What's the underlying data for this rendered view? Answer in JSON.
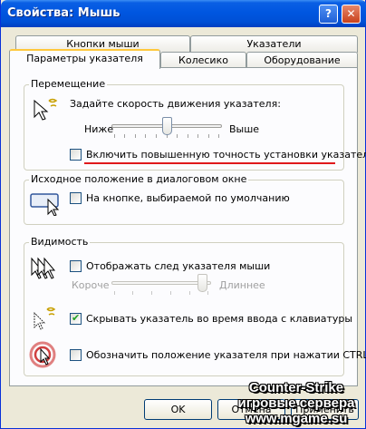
{
  "window": {
    "title": "Свойства: Мышь",
    "help_glyph": "?",
    "close_glyph": "✕"
  },
  "tabs": {
    "row_back": [
      {
        "label": "Кнопки мыши"
      },
      {
        "label": "Указатели"
      }
    ],
    "row_front": [
      {
        "label": "Параметры указателя",
        "active": true
      },
      {
        "label": "Колесико"
      },
      {
        "label": "Оборудование"
      }
    ]
  },
  "motion": {
    "legend": "Перемещение",
    "speed_label": "Задайте скорость движения указателя:",
    "slow_label": "Ниже",
    "fast_label": "Выше",
    "speed_level": 0.5,
    "precision_label": "Включить повышенную точность установки указателя",
    "precision_checked": false,
    "icon": "pointer-speed-icon"
  },
  "snap_to": {
    "legend": "Исходное положение в диалоговом окне",
    "label": "На кнопке, выбираемой по умолчанию",
    "checked": false,
    "icon": "snap-to-button-icon"
  },
  "visibility": {
    "legend": "Видимость",
    "trails_label": "Отображать след указателя мыши",
    "trails_checked": false,
    "trails_short": "Короче",
    "trails_long": "Длиннее",
    "trails_level": 1.0,
    "hide_label": "Скрывать указатель во время ввода с клавиатуры",
    "hide_checked": true,
    "show_ctrl_label": "Обозначить положение указателя при нажатии CTRL",
    "show_ctrl_checked": false,
    "icons": [
      "pointer-trails-icon",
      "hide-pointer-icon",
      "ctrl-locate-icon"
    ]
  },
  "buttons": {
    "ok": "OK",
    "cancel": "Отмена",
    "apply": "Применить"
  },
  "watermark": {
    "line1": "Counter-Strike",
    "line2": "игровые сервера",
    "line3": "www.mgame.su"
  },
  "colors": {
    "titlebar": "#0054e3",
    "dialog_bg": "#ece9d8",
    "highlight_underline": "#e0191c",
    "active_tab_accent": "#ffc83c"
  }
}
